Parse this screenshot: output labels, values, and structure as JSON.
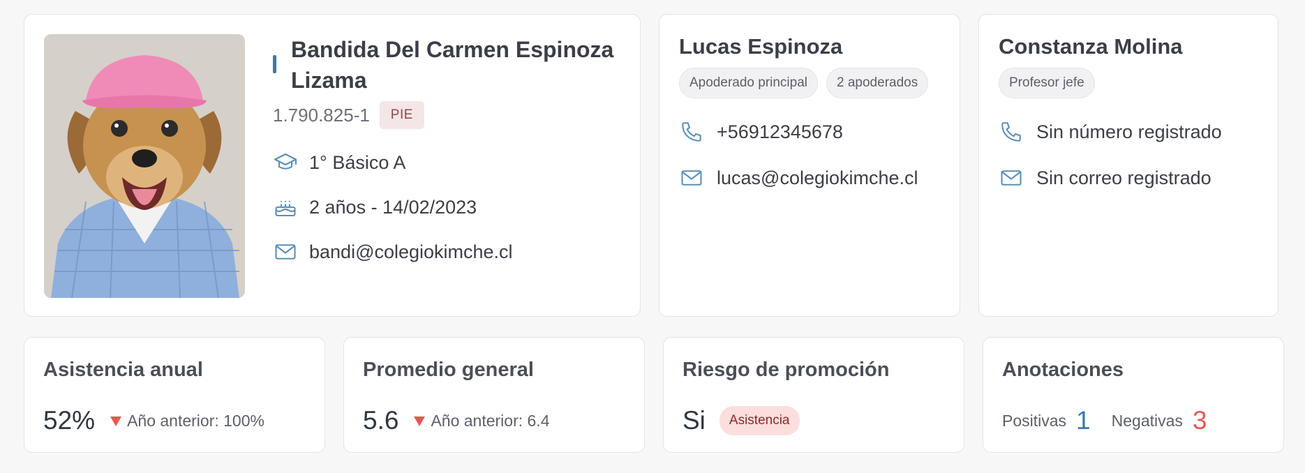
{
  "student": {
    "name": "Bandida Del Carmen Espinoza Lizama",
    "rut": "1.790.825-1",
    "badge": "PIE",
    "course": "1° Básico A",
    "age_birthdate": "2 años - 14/02/2023",
    "email": "bandi@colegiokimche.cl",
    "icons": [
      "graduation-cap-icon",
      "cake-icon",
      "mail-icon"
    ]
  },
  "guardian": {
    "name": "Lucas Espinoza",
    "badges": [
      "Apoderado principal",
      "2 apoderados"
    ],
    "phone": "+56912345678",
    "email": "lucas@colegiokimche.cl"
  },
  "teacher": {
    "name": "Constanza Molina",
    "badges": [
      "Profesor jefe"
    ],
    "phone": "Sin número registrado",
    "email": "Sin correo registrado"
  },
  "stats": {
    "attendance": {
      "title": "Asistencia anual",
      "value": "52%",
      "previous": "Año anterior: 100%"
    },
    "average": {
      "title": "Promedio general",
      "value": "5.6",
      "previous": "Año anterior: 6.4"
    },
    "risk": {
      "title": "Riesgo de promoción",
      "value": "Si",
      "badge": "Asistencia"
    },
    "notes": {
      "title": "Anotaciones",
      "positive_label": "Positivas",
      "positive_count": "1",
      "negative_label": "Negativas",
      "negative_count": "3"
    }
  },
  "colors": {
    "accent": "#3f78a8",
    "negative": "#e05a52",
    "pie_badge_bg": "#f4e6e6",
    "risk_badge_bg": "#fbdedd"
  }
}
